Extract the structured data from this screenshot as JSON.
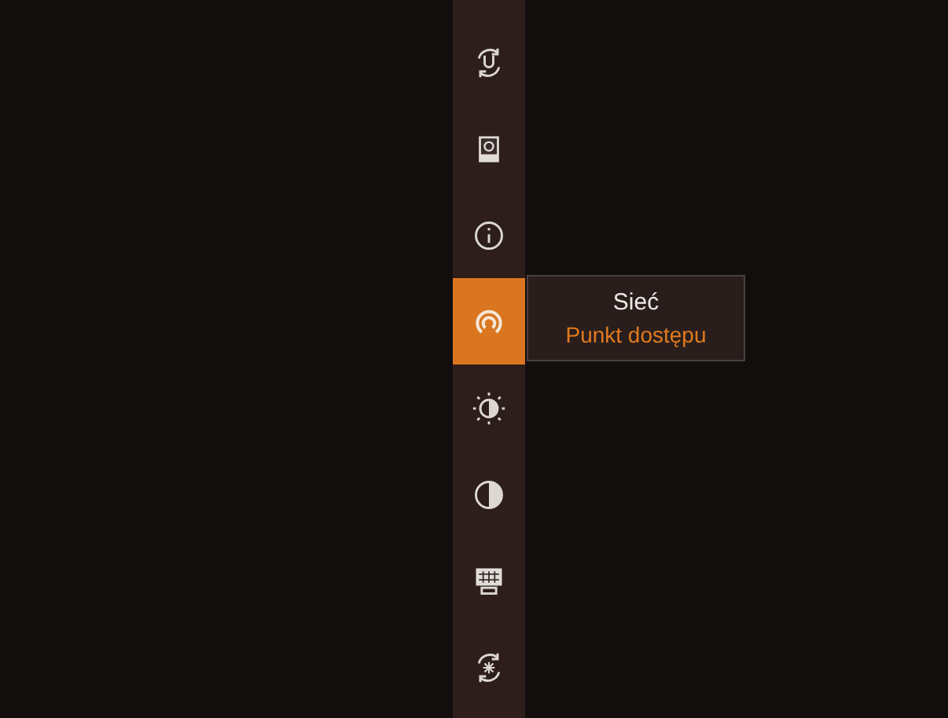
{
  "menu": [
    {
      "kind": "restart",
      "selected": false
    },
    {
      "kind": "calibrate",
      "selected": false
    },
    {
      "kind": "info",
      "selected": false
    },
    {
      "kind": "network",
      "selected": true
    },
    {
      "kind": "brightness",
      "selected": false
    },
    {
      "kind": "contrast",
      "selected": false
    },
    {
      "kind": "display",
      "selected": false
    },
    {
      "kind": "reset",
      "selected": false
    }
  ],
  "tooltip": {
    "title": "Sieć",
    "value": "Punkt dostępu"
  }
}
